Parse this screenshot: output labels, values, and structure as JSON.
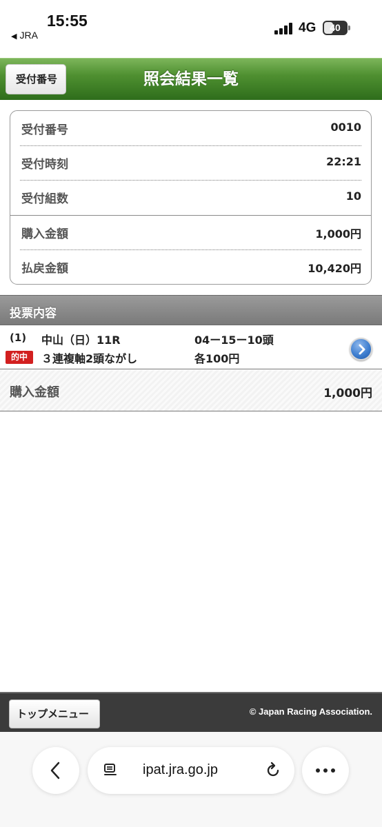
{
  "status_bar": {
    "time": "15:55",
    "back_app": "JRA",
    "network": "4G",
    "battery": "40",
    "battery_level": 0.4
  },
  "header": {
    "back_label": "受付番号",
    "title": "照会結果一覧"
  },
  "info": {
    "rows": [
      {
        "label": "受付番号",
        "value": "0010"
      },
      {
        "label": "受付時刻",
        "value": "22:21"
      },
      {
        "label": "受付組数",
        "value": "10"
      },
      {
        "label": "購入金額",
        "value": "1,000円"
      },
      {
        "label": "払戻金額",
        "value": "10,420円"
      }
    ]
  },
  "votes": {
    "section_title": "投票内容",
    "bet": {
      "number": "(1)",
      "race": "中山（日）11R",
      "combo": "04ー15ー10頭",
      "hit_badge": "的中",
      "type": "３連複軸2頭ながし",
      "each": "各100円"
    },
    "total_label": "購入金額",
    "total_value": "1,000円"
  },
  "footer": {
    "top_menu": "トップメニュー",
    "copyright": "© Japan Racing Association."
  },
  "browser": {
    "url": "ipat.jra.go.jp"
  },
  "icons": {
    "back": "chevron-left-icon",
    "reader": "reader-icon",
    "reload": "reload-icon",
    "more": "more-icon",
    "go": "chevron-right-icon"
  },
  "colors": {
    "header_green": "#4f9031",
    "hit_red": "#d21f1f",
    "go_blue": "#3f7fd0"
  }
}
